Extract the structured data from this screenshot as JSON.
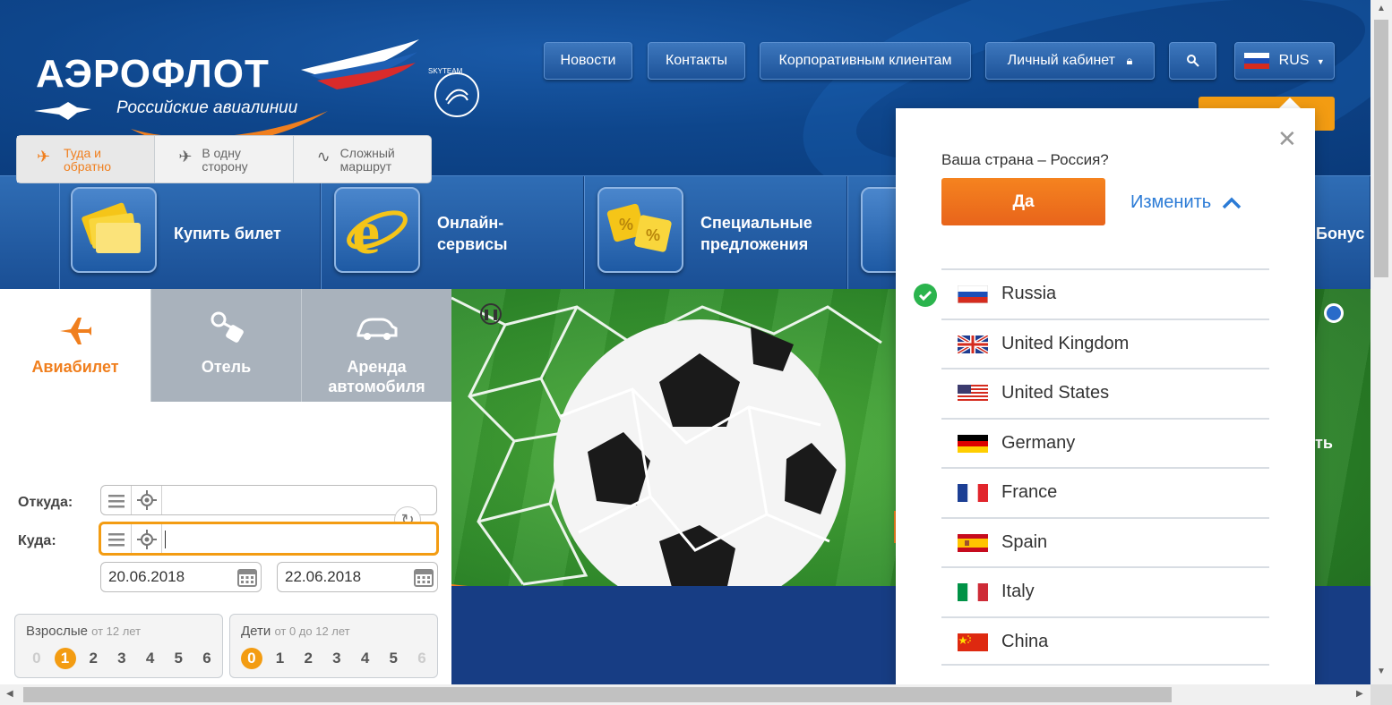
{
  "header": {
    "logo_title": "АЭРОФЛОТ",
    "logo_subtitle": "Российские авиалинии",
    "skyteam": "SKYTEAM",
    "nav": [
      {
        "label": "Новости"
      },
      {
        "label": "Контакты"
      },
      {
        "label": "Корпоративным клиентам"
      },
      {
        "label": "Личный кабинет"
      }
    ],
    "language": "RUS"
  },
  "services": [
    {
      "label": "Купить билет"
    },
    {
      "label": "Онлайн-\nсервисы",
      "line1": "Онлайн-",
      "line2": "сервисы"
    },
    {
      "label": "Специальные предложения",
      "line1": "Специальные",
      "line2": "предложения"
    },
    {
      "label": "Бонус"
    }
  ],
  "booking": {
    "tabs": [
      {
        "label": "Авиабилет"
      },
      {
        "label": "Отель"
      },
      {
        "label": "Аренда автомобиля",
        "line1": "Аренда",
        "line2": "автомобиля"
      }
    ],
    "trip_types": [
      {
        "line1": "Туда и",
        "line2": "обратно"
      },
      {
        "line1": "В одну",
        "line2": "сторону"
      },
      {
        "line1": "Сложный",
        "line2": "маршрут"
      }
    ],
    "from_label": "Откуда:",
    "to_label": "Куда:",
    "from_value": "",
    "to_value": "",
    "date_out": "20.06.2018",
    "date_back": "22.06.2018",
    "adults": {
      "title": "Взрослые",
      "sub": "от 12 лет",
      "options": [
        "0",
        "1",
        "2",
        "3",
        "4",
        "5",
        "6"
      ],
      "selected": "1"
    },
    "children": {
      "title": "Дети",
      "sub": "от 0 до 12 лет",
      "options": [
        "0",
        "1",
        "2",
        "3",
        "4",
        "5",
        "6"
      ],
      "selected": "0"
    }
  },
  "banner": {
    "peek_text": "ть"
  },
  "country_popup": {
    "question": "Ваша страна – Россия?",
    "yes_label": "Да",
    "change_label": "Изменить",
    "countries": [
      {
        "name": "Russia",
        "selected": true
      },
      {
        "name": "United Kingdom"
      },
      {
        "name": "United States"
      },
      {
        "name": "Germany"
      },
      {
        "name": "France"
      },
      {
        "name": "Spain"
      },
      {
        "name": "Italy"
      },
      {
        "name": "China"
      }
    ]
  },
  "colors": {
    "brand_blue": "#0e468c",
    "accent_orange": "#f07f1e",
    "link_blue": "#2b7bd6",
    "check_green": "#2bb44d"
  }
}
